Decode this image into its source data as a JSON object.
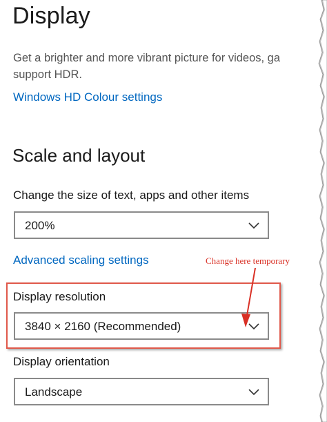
{
  "page": {
    "title": "Display",
    "description_line1": "Get a brighter and more vibrant picture for videos, ga",
    "description_line2": "support HDR.",
    "hd_colour_link": "Windows HD Colour settings"
  },
  "scale_layout": {
    "heading": "Scale and layout",
    "scale_label": "Change the size of text, apps and other items",
    "scale_value": "200%",
    "advanced_link": "Advanced scaling settings",
    "resolution_label": "Display resolution",
    "resolution_value": "3840 × 2160 (Recommended)",
    "orientation_label": "Display orientation",
    "orientation_value": "Landscape"
  },
  "annotation": {
    "text": "Change here temporary",
    "color": "#d93025"
  },
  "colors": {
    "link": "#0067c0",
    "highlight": "#e0584a"
  },
  "icons": {
    "dropdown": "chevron-down-icon",
    "arrow": "red-arrow-icon"
  }
}
